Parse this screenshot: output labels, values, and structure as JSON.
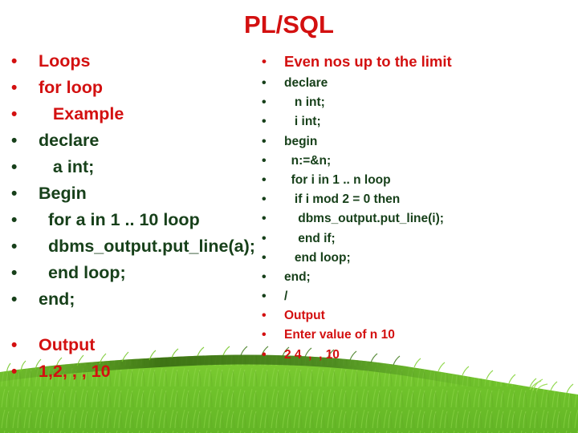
{
  "slide": {
    "title": "PL/SQL",
    "title_color": "#d31010",
    "background_color": "#ffffff",
    "bullet_glyph": "•"
  },
  "colors": {
    "heading_red": "#d31010",
    "code_green": "#17401a",
    "grass_light": "#76c82b",
    "grass_mid": "#6ab828",
    "grass_dark": "#3f7a1c"
  },
  "left_column": {
    "lines": [
      {
        "text": "Loops",
        "color": "red"
      },
      {
        "text": "for loop",
        "color": "red"
      },
      {
        "text": "   Example",
        "color": "red"
      },
      {
        "text": "declare",
        "color": "green"
      },
      {
        "text": "   a int;",
        "color": "green"
      },
      {
        "text": "Begin",
        "color": "green"
      },
      {
        "text": "  for a in 1 .. 10 loop",
        "color": "green"
      },
      {
        "text": "  dbms_output.put_line(a);",
        "color": "green"
      },
      {
        "text": "  end loop;",
        "color": "green"
      },
      {
        "text": "end;",
        "color": "green"
      },
      {
        "text": "",
        "color": "green",
        "spacer": true
      },
      {
        "text": "Output",
        "color": "red"
      },
      {
        "text": "1,2, , , 10",
        "color": "red"
      }
    ]
  },
  "right_column": {
    "lines": [
      {
        "text": "Even nos up to the limit",
        "color": "red",
        "lead": true
      },
      {
        "text": "declare",
        "color": "green"
      },
      {
        "text": "   n int;",
        "color": "green"
      },
      {
        "text": "   i int;",
        "color": "green"
      },
      {
        "text": "begin",
        "color": "green"
      },
      {
        "text": "  n:=&n;",
        "color": "green"
      },
      {
        "text": "  for i in 1 .. n loop",
        "color": "green"
      },
      {
        "text": "   if i mod 2 = 0 then",
        "color": "green"
      },
      {
        "text": "    dbms_output.put_line(i);",
        "color": "green"
      },
      {
        "text": "    end if;",
        "color": "green"
      },
      {
        "text": "   end loop;",
        "color": "green"
      },
      {
        "text": "end;",
        "color": "green"
      },
      {
        "text": "/",
        "color": "green"
      },
      {
        "text": "Output",
        "color": "red"
      },
      {
        "text": "Enter value of n 10",
        "color": "red"
      },
      {
        "text": "2 4  ,  , 10",
        "color": "red"
      }
    ]
  }
}
